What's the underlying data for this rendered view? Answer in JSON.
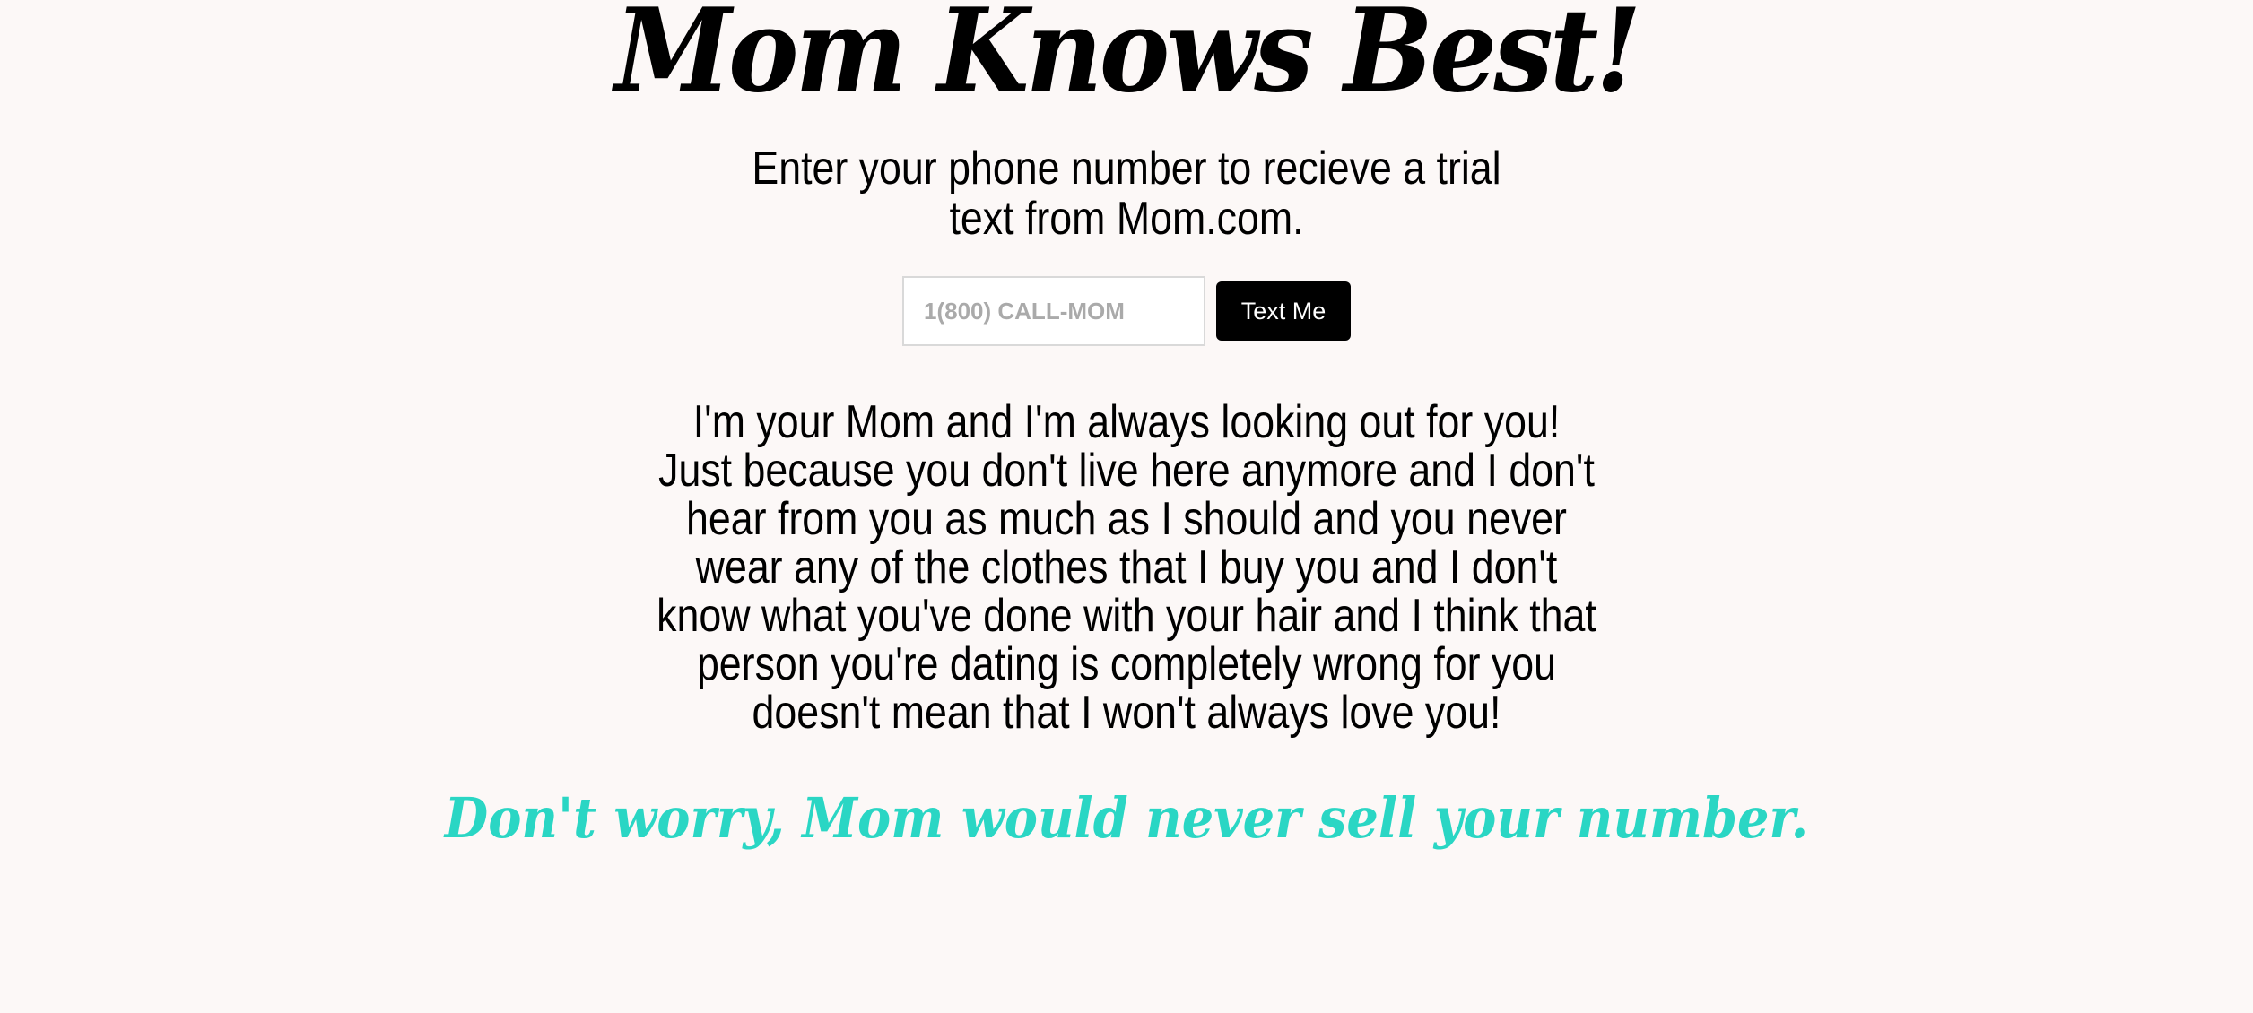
{
  "header": {
    "title": "Mom Knows Best!"
  },
  "intro": {
    "text": "Enter your phone number to recieve a trial text from Mom.com."
  },
  "form": {
    "phone_placeholder": "1(800) CALL-MOM",
    "phone_value": "",
    "submit_label": "Text Me"
  },
  "message": {
    "text": "I'm your Mom and I'm always looking out for you! Just because you don't live here anymore and I don't hear from you as much as I should and you never wear any of the clothes that I buy you and I don't know what you've done with your hair and I think that person you're dating is completely wrong for you doesn't mean that I won't always love you!"
  },
  "footer": {
    "privacy_note": "Don't worry, Mom would never sell your number."
  },
  "colors": {
    "background": "#fcf8f7",
    "accent_teal": "#2ad6c4",
    "button": "#000000"
  }
}
